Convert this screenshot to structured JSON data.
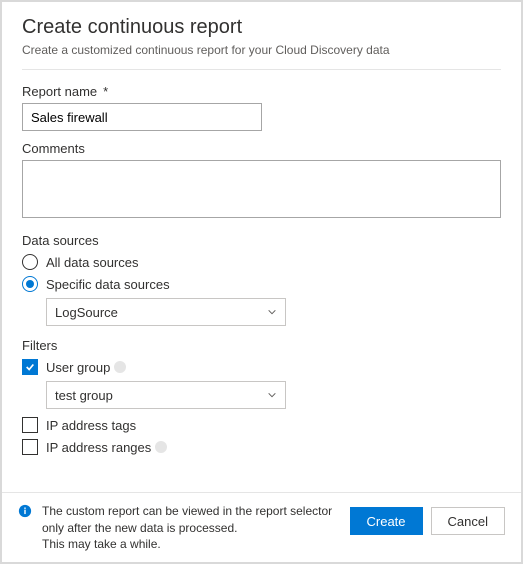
{
  "header": {
    "title": "Create continuous report",
    "subtitle": "Create a customized continuous report for your Cloud Discovery data"
  },
  "report_name": {
    "label": "Report name",
    "required_mark": "*",
    "value": "Sales firewall"
  },
  "comments": {
    "label": "Comments",
    "value": ""
  },
  "data_sources": {
    "label": "Data sources",
    "options": {
      "all": "All data sources",
      "specific": "Specific data sources"
    },
    "select_value": "LogSource"
  },
  "filters": {
    "label": "Filters",
    "user_group": {
      "label": "User group",
      "select_value": "test group"
    },
    "ip_tags": {
      "label": "IP address tags"
    },
    "ip_ranges": {
      "label": "IP address ranges"
    }
  },
  "footer": {
    "info_line1": "The custom report can be viewed in the report selector only after the new data is processed.",
    "info_line2": "This may take a while.",
    "create": "Create",
    "cancel": "Cancel"
  }
}
